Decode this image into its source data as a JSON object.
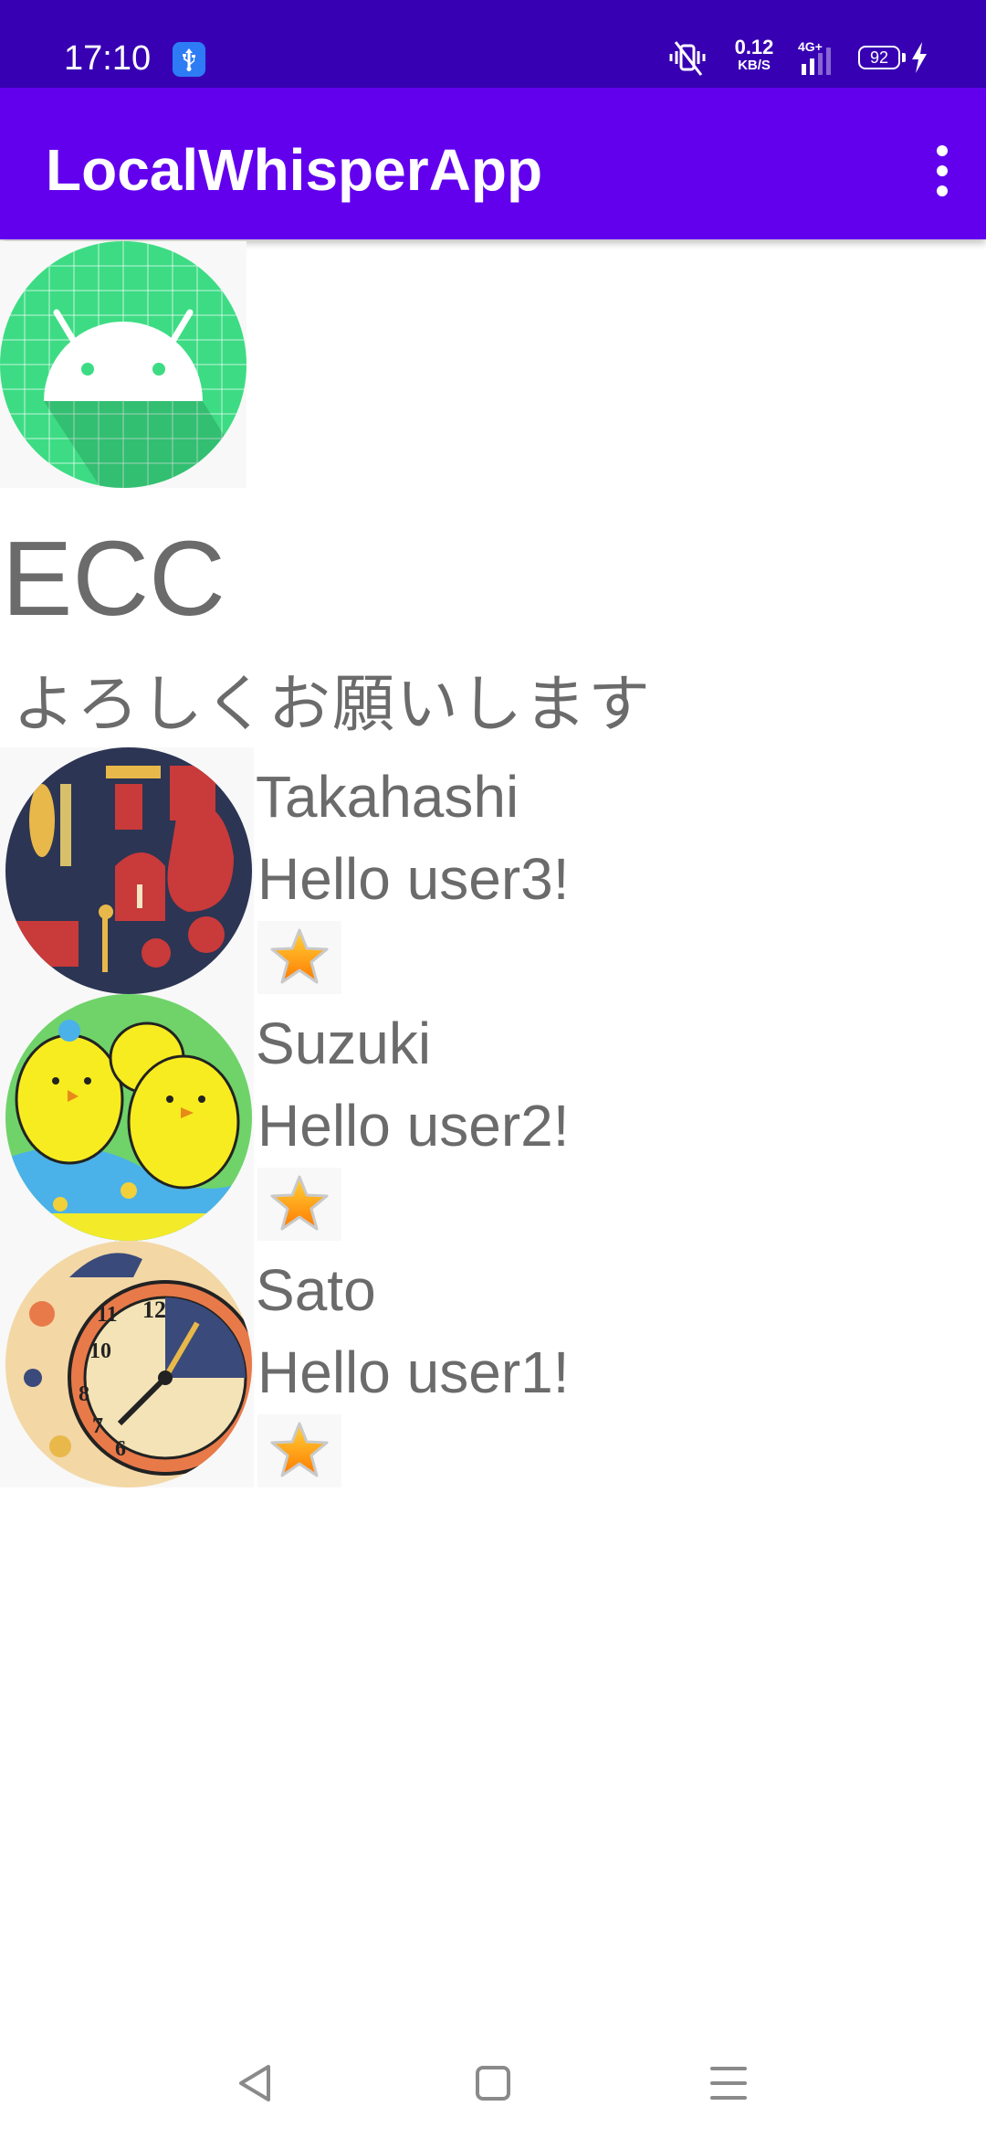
{
  "status_bar": {
    "time": "17:10",
    "speed_value": "0.12",
    "speed_unit": "KB/S",
    "network": "4G+",
    "battery": "92",
    "icons": [
      "usb-icon",
      "vibrate-mute-icon",
      "signal-icon",
      "battery-icon",
      "charging-bolt-icon"
    ]
  },
  "app_bar": {
    "title": "LocalWhisperApp",
    "menu_icon": "more-vert-icon"
  },
  "profile": {
    "icon": "android-icon",
    "name": "ECC",
    "message": "よろしくお願いします"
  },
  "users": [
    {
      "name": "Takahashi",
      "message": "Hello user3!",
      "avatar": "kitchen-utensils-avatar",
      "favorite": true
    },
    {
      "name": "Suzuki",
      "message": "Hello user2!",
      "avatar": "chicks-avatar",
      "favorite": true
    },
    {
      "name": "Sato",
      "message": "Hello user1!",
      "avatar": "clock-avatar",
      "favorite": true
    }
  ],
  "nav_bar": {
    "icons": [
      "back-icon",
      "home-icon",
      "recents-icon"
    ]
  },
  "colors": {
    "status_bar": "#3700b3",
    "app_bar": "#6200ee",
    "text_gray": "#6b6b6b",
    "android_green": "#3ddc84"
  }
}
